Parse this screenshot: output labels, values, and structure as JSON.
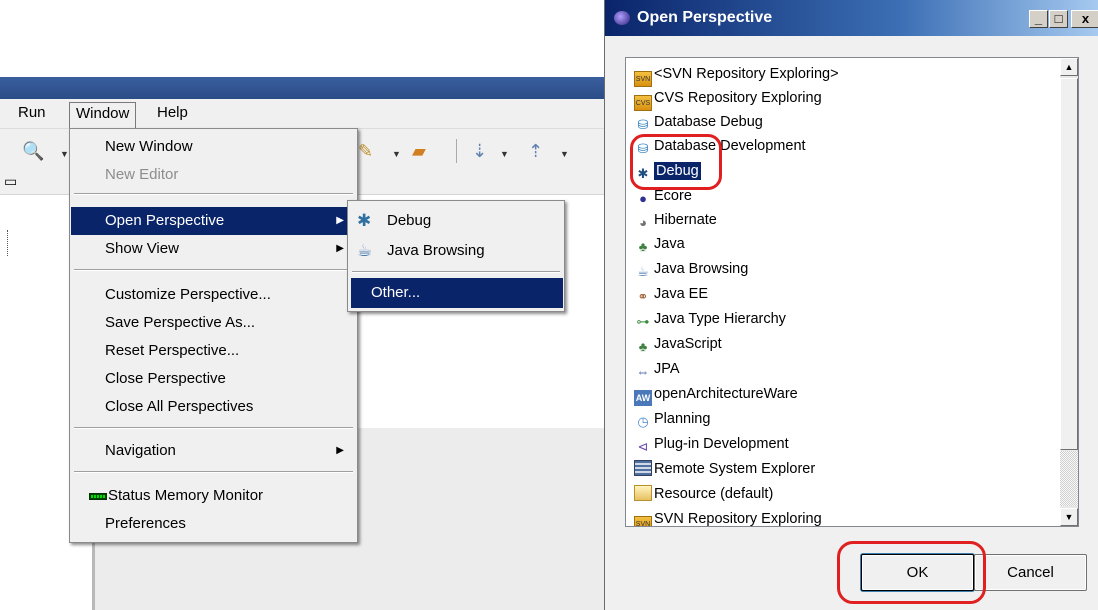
{
  "ide": {
    "menubar": [
      "Run",
      "Window",
      "Help"
    ],
    "window_menu": {
      "items": [
        {
          "label": "New Window",
          "disabled": false
        },
        {
          "label": "New Editor",
          "disabled": true
        },
        {
          "label": "Open Perspective",
          "submenu": true
        },
        {
          "label": "Show View",
          "submenu": true
        },
        {
          "label": "Customize Perspective..."
        },
        {
          "label": "Save Perspective As..."
        },
        {
          "label": "Reset Perspective..."
        },
        {
          "label": "Close Perspective"
        },
        {
          "label": "Close All Perspectives"
        },
        {
          "label": "Navigation",
          "submenu": true
        },
        {
          "label": "Status Memory Monitor"
        },
        {
          "label": "Preferences"
        }
      ]
    },
    "perspective_submenu": {
      "items": [
        {
          "label": "Debug",
          "icon": "debug-icon"
        },
        {
          "label": "Java Browsing",
          "icon": "java-browsing-icon"
        },
        {
          "label": "Other..."
        }
      ]
    }
  },
  "dialog": {
    "title": "Open Perspective",
    "perspectives": [
      {
        "label": "<SVN Repository Exploring>",
        "icon": "svn-repository-icon"
      },
      {
        "label": "CVS Repository Exploring",
        "icon": "cvs-repository-icon"
      },
      {
        "label": "Database Debug",
        "icon": "database-debug-icon"
      },
      {
        "label": "Database Development",
        "icon": "database-icon"
      },
      {
        "label": "Debug",
        "icon": "debug-icon",
        "selected": true
      },
      {
        "label": "Ecore",
        "icon": "ecore-icon"
      },
      {
        "label": "Hibernate",
        "icon": "hibernate-icon"
      },
      {
        "label": "Java",
        "icon": "java-icon"
      },
      {
        "label": "Java Browsing",
        "icon": "java-browsing-icon"
      },
      {
        "label": "Java EE",
        "icon": "java-ee-icon"
      },
      {
        "label": "Java Type Hierarchy",
        "icon": "java-type-hierarchy-icon"
      },
      {
        "label": "JavaScript",
        "icon": "javascript-icon"
      },
      {
        "label": "JPA",
        "icon": "jpa-icon"
      },
      {
        "label": "openArchitectureWare",
        "icon": "oaw-icon"
      },
      {
        "label": "Planning",
        "icon": "planning-icon"
      },
      {
        "label": "Plug-in Development",
        "icon": "plugin-icon"
      },
      {
        "label": "Remote System Explorer",
        "icon": "remote-system-icon"
      },
      {
        "label": "Resource (default)",
        "icon": "resource-folder-icon"
      },
      {
        "label": "SVN Repository Exploring",
        "icon": "svn-repository-icon"
      }
    ],
    "ok_label": "OK",
    "cancel_label": "Cancel"
  },
  "colors": {
    "selection": "#0a246a",
    "annotation": "#e02020"
  }
}
